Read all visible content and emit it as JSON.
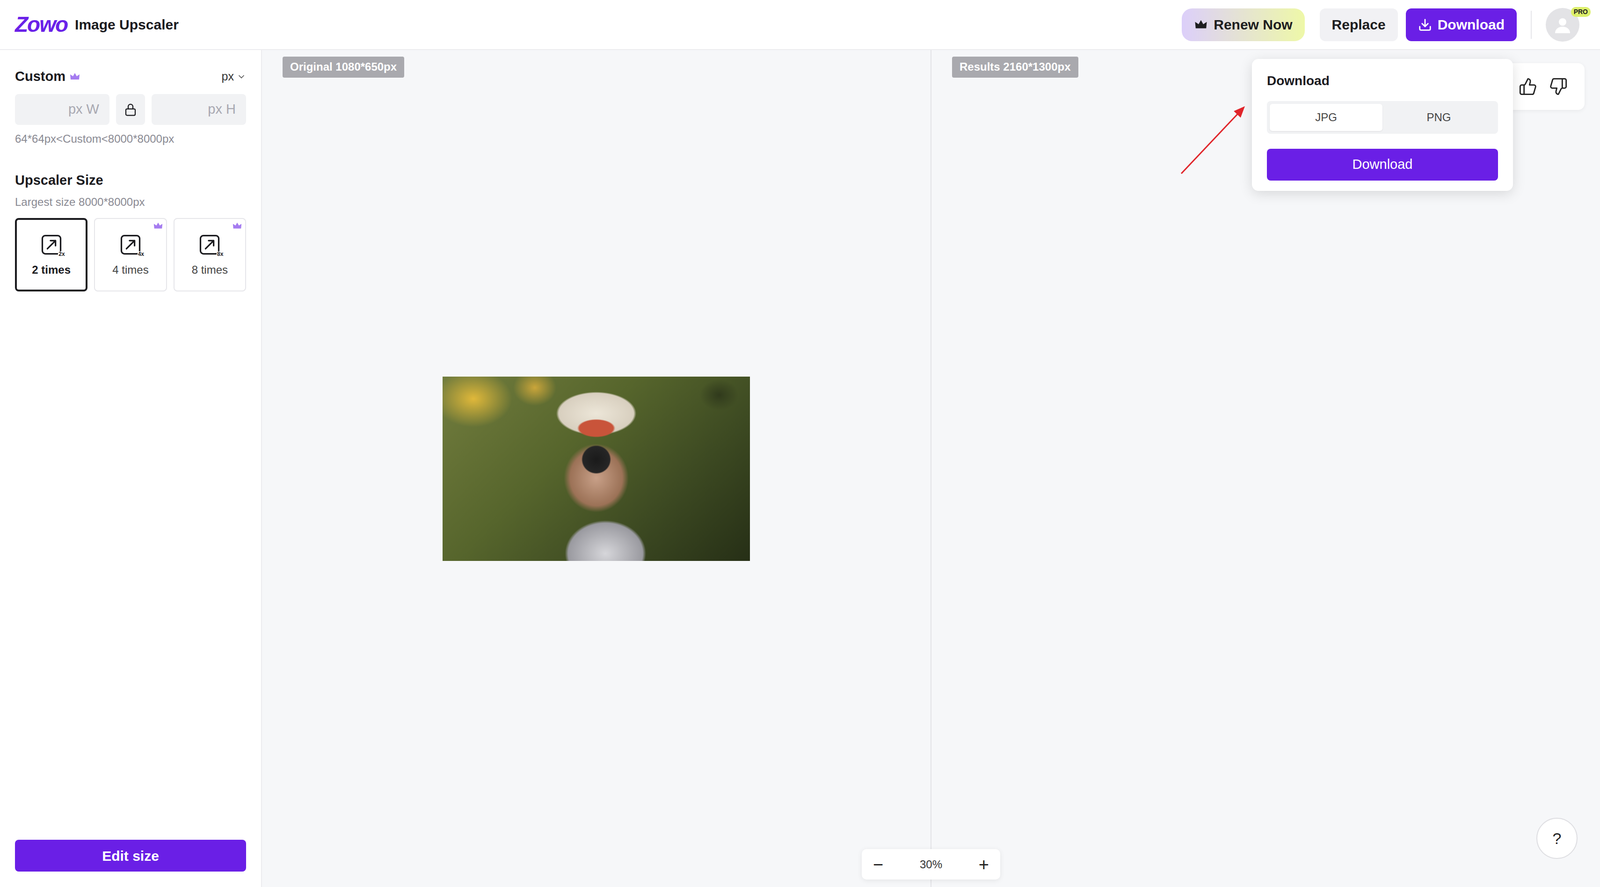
{
  "app": {
    "logo": "Zowo",
    "title": "Image Upscaler"
  },
  "header_buttons": [
    {
      "label": "Renew Now",
      "kind": "renew"
    },
    {
      "label": "Replace",
      "kind": "plain"
    },
    {
      "label": "Download",
      "kind": "primary"
    }
  ],
  "avatar": {
    "badge": "PRO"
  },
  "sidebar": {
    "custom": {
      "title": "Custom",
      "pro": true,
      "unit": "px",
      "width_placeholder": "px W",
      "locked": true,
      "height_placeholder": "px H",
      "hint": "64*64px<Custom<8000*8000px"
    },
    "upscale": {
      "title": "Upscaler Size",
      "hint": "Largest size 8000*8000px",
      "options": [
        {
          "icon_label": "2x",
          "label": "2 times",
          "pro": false,
          "selected": true
        },
        {
          "icon_label": "4x",
          "label": "4 times",
          "pro": true,
          "selected": false
        },
        {
          "icon_label": "8x",
          "label": "8 times",
          "pro": true,
          "selected": false
        }
      ]
    },
    "edit_button": "Edit size"
  },
  "panes": [
    {
      "label": "Original 1080*650px"
    },
    {
      "label": "Results 2160*1300px"
    }
  ],
  "download_menu": {
    "title": "Download",
    "formats": [
      {
        "label": "JPG",
        "selected": true
      },
      {
        "label": "PNG",
        "selected": false
      }
    ],
    "button": "Download"
  },
  "zoom": {
    "minus": "−",
    "value": "30%",
    "plus": "+"
  },
  "help": "?"
}
